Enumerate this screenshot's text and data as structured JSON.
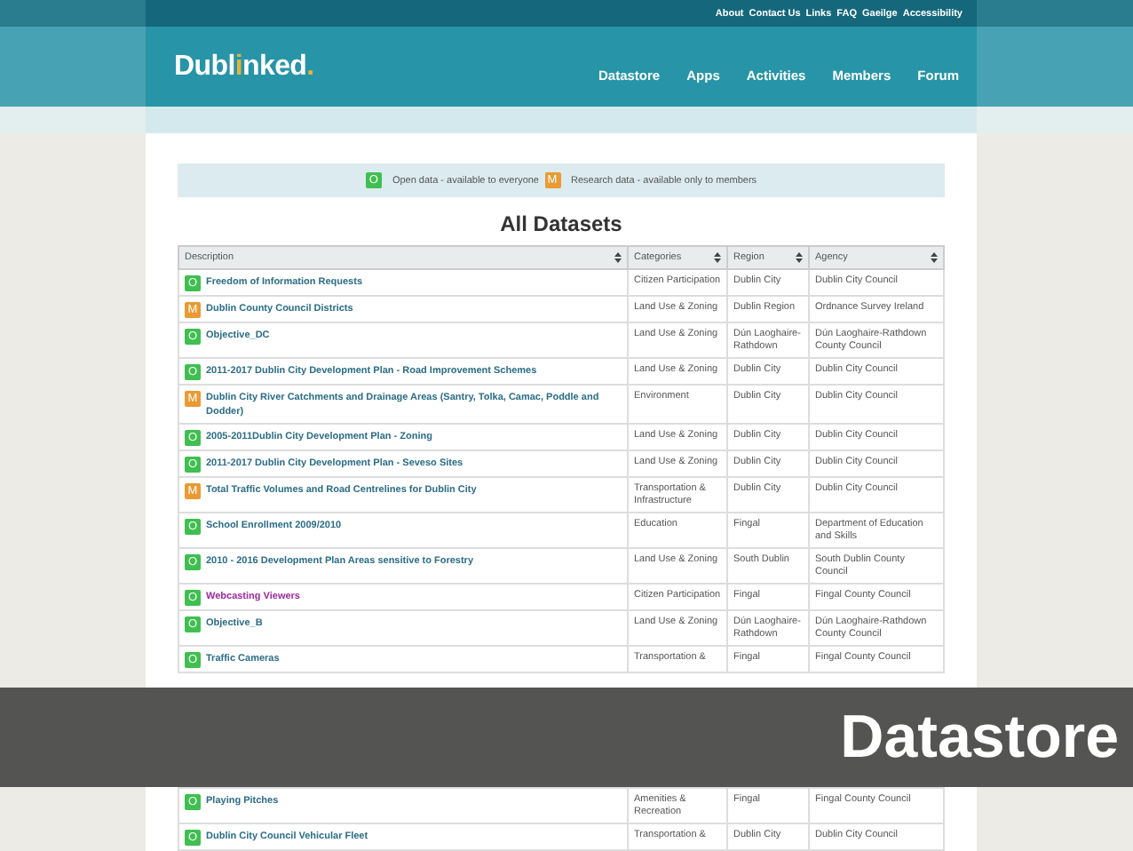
{
  "top_links": [
    "About",
    "Contact Us",
    "Links",
    "FAQ",
    "Gaeilge",
    "Accessibility"
  ],
  "logo": {
    "before": "Dubl",
    "mark": "i",
    "after": "nked",
    "dot": "."
  },
  "nav": [
    "Datastore",
    "Apps",
    "Activities",
    "Members",
    "Forum"
  ],
  "legend": [
    {
      "kind": "open",
      "badge": "O",
      "text": "Open data - available to everyone"
    },
    {
      "kind": "research",
      "badge": "M",
      "text": "Research data - available only to members"
    }
  ],
  "title": "All Datasets",
  "table": {
    "columns": [
      "Description",
      "Categories",
      "Region",
      "Agency"
    ],
    "rows": [
      {
        "kind": "open",
        "badge": "O",
        "description": "Freedom of Information Requests",
        "visited": false,
        "category": "Citizen Participation",
        "region": "Dublin City",
        "agency": "Dublin City Council"
      },
      {
        "kind": "research",
        "badge": "M",
        "description": "Dublin County Council Districts",
        "visited": false,
        "category": "Land Use & Zoning",
        "region": "Dublin Region",
        "agency": "Ordnance Survey Ireland"
      },
      {
        "kind": "open",
        "badge": "O",
        "description": "Objective_DC",
        "visited": false,
        "category": "Land Use & Zoning",
        "region": "Dún Laoghaire-Rathdown",
        "agency": "Dún Laoghaire-Rathdown County Council"
      },
      {
        "kind": "open",
        "badge": "O",
        "description": "2011-2017 Dublin City Development Plan - Road Improvement Schemes",
        "visited": false,
        "category": "Land Use & Zoning",
        "region": "Dublin City",
        "agency": "Dublin City Council"
      },
      {
        "kind": "research",
        "badge": "M",
        "description": "Dublin City River Catchments and Drainage Areas (Santry, Tolka, Camac, Poddle and Dodder)",
        "visited": false,
        "category": "Environment",
        "region": "Dublin City",
        "agency": "Dublin City Council"
      },
      {
        "kind": "open",
        "badge": "O",
        "description": "2005-2011Dublin City Development Plan - Zoning",
        "visited": false,
        "category": "Land Use & Zoning",
        "region": "Dublin City",
        "agency": "Dublin City Council"
      },
      {
        "kind": "open",
        "badge": "O",
        "description": "2011-2017 Dublin City Development Plan - Seveso Sites",
        "visited": false,
        "category": "Land Use & Zoning",
        "region": "Dublin City",
        "agency": "Dublin City Council"
      },
      {
        "kind": "research",
        "badge": "M",
        "description": "Total Traffic Volumes and Road Centrelines for Dublin City",
        "visited": false,
        "category": "Transportation & Infrastructure",
        "region": "Dublin City",
        "agency": "Dublin City Council"
      },
      {
        "kind": "open",
        "badge": "O",
        "description": "School Enrollment 2009/2010",
        "visited": false,
        "category": "Education",
        "region": "Fingal",
        "agency": "Department of Education and Skills"
      },
      {
        "kind": "open",
        "badge": "O",
        "description": "2010 - 2016 Development Plan Areas sensitive to Forestry",
        "visited": false,
        "category": "Land Use & Zoning",
        "region": "South Dublin",
        "agency": "South Dublin County Council"
      },
      {
        "kind": "open",
        "badge": "O",
        "description": "Webcasting Viewers",
        "visited": true,
        "category": "Citizen Participation",
        "region": "Fingal",
        "agency": "Fingal County Council"
      },
      {
        "kind": "open",
        "badge": "O",
        "description": "Objective_B",
        "visited": false,
        "category": "Land Use & Zoning",
        "region": "Dún Laoghaire-Rathdown",
        "agency": "Dún Laoghaire-Rathdown County Council"
      },
      {
        "kind": "open",
        "badge": "O",
        "description": "Traffic Cameras",
        "visited": false,
        "category": "Transportation &",
        "region": "Fingal",
        "agency": "Fingal County Council"
      }
    ],
    "rows_after_banner": [
      {
        "kind": "open",
        "badge": "O",
        "description": "Playing Pitches",
        "visited": false,
        "category": "Amenities & Recreation",
        "region": "Fingal",
        "agency": "Fingal County Council"
      },
      {
        "kind": "open",
        "badge": "O",
        "description": "Dublin City Council Vehicular Fleet",
        "visited": false,
        "category": "Transportation &",
        "region": "Dublin City",
        "agency": "Dublin City Council"
      }
    ]
  },
  "banner": "Datastore"
}
